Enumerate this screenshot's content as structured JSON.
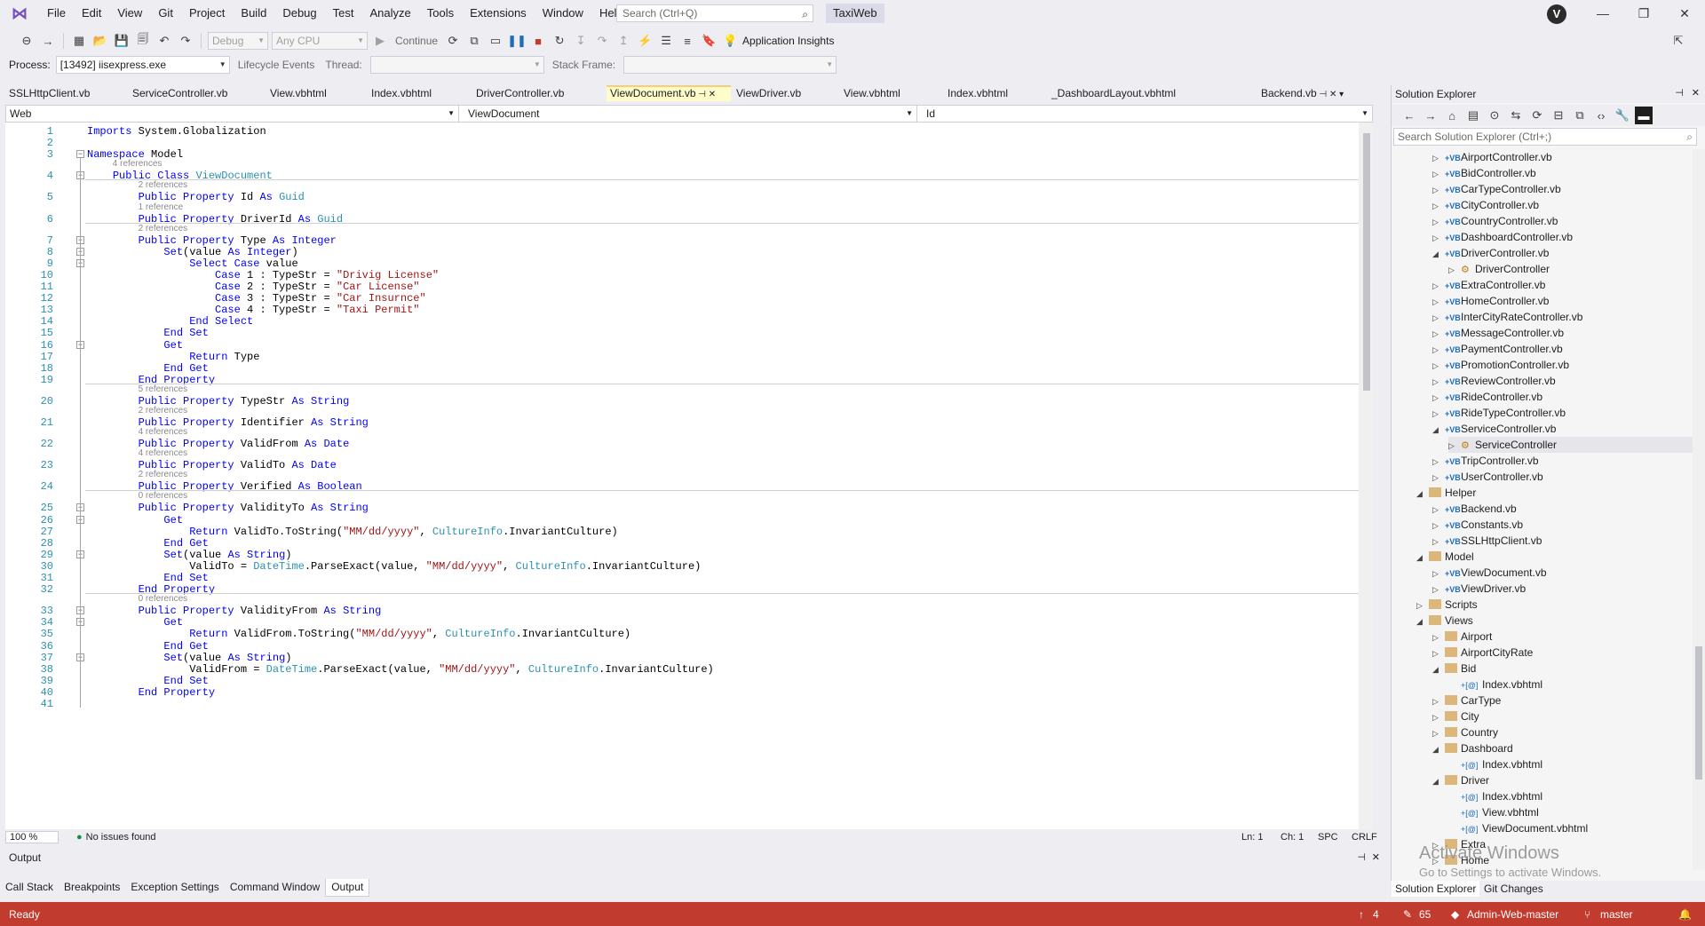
{
  "menu": {
    "items": [
      "File",
      "Edit",
      "View",
      "Git",
      "Project",
      "Build",
      "Debug",
      "Test",
      "Analyze",
      "Tools",
      "Extensions",
      "Window",
      "Help"
    ],
    "search_placeholder": "Search (Ctrl+Q)",
    "solution_name": "TaxiWeb",
    "user_initial": "V"
  },
  "toolbar": {
    "config": "Debug",
    "platform": "Any CPU",
    "continue_label": "Continue",
    "app_insights": "Application Insights"
  },
  "process_bar": {
    "process_label": "Process:",
    "process_value": "[13492] iisexpress.exe",
    "lifecycle": "Lifecycle Events",
    "thread_label": "Thread:",
    "stack_label": "Stack Frame:"
  },
  "tabs": [
    "SSLHttpClient.vb",
    "ServiceController.vb",
    "View.vbhtml",
    "Index.vbhtml",
    "DriverController.vb",
    "ViewDocument.vb",
    "ViewDriver.vb",
    "View.vbhtml",
    "Index.vbhtml",
    "_DashboardLayout.vbhtml"
  ],
  "active_tab": "ViewDocument.vb",
  "right_tab": "Backend.vb",
  "navbar": {
    "project": "Web",
    "class": "ViewDocument",
    "member": "Id"
  },
  "editor": {
    "lines": [
      {
        "n": "1",
        "html": "<span class='kw'>Imports</span> System.Globalization"
      },
      {
        "n": "2",
        "html": ""
      },
      {
        "n": "3",
        "html": "<span class='kw'>Namespace</span> Model"
      },
      {
        "n": "4",
        "html": "    <span class='kw'>Public Class</span> <span class='ty'>ViewDocument</span>"
      },
      {
        "n": "5",
        "html": "        <span class='kw'>Public Property</span> Id <span class='kw'>As</span> <span class='ty'>Guid</span>"
      },
      {
        "n": "6",
        "html": "        <span class='kw'>Public Property</span> DriverId <span class='kw'>As</span> <span class='ty'>Guid</span>"
      },
      {
        "n": "7",
        "html": "        <span class='kw'>Public Property</span> Type <span class='kw'>As Integer</span>"
      },
      {
        "n": "8",
        "html": "            <span class='kw'>Set</span>(value <span class='kw'>As Integer</span>)"
      },
      {
        "n": "9",
        "html": "                <span class='kw'>Select Case</span> value"
      },
      {
        "n": "10",
        "html": "                    <span class='kw'>Case</span> 1 : TypeStr = <span class='st'>\"Drivig License\"</span>"
      },
      {
        "n": "11",
        "html": "                    <span class='kw'>Case</span> 2 : TypeStr = <span class='st'>\"Car License\"</span>"
      },
      {
        "n": "12",
        "html": "                    <span class='kw'>Case</span> 3 : TypeStr = <span class='st'>\"Car Insurnce\"</span>"
      },
      {
        "n": "13",
        "html": "                    <span class='kw'>Case</span> 4 : TypeStr = <span class='st'>\"Taxi Permit\"</span>"
      },
      {
        "n": "14",
        "html": "                <span class='kw'>End Select</span>"
      },
      {
        "n": "15",
        "html": "            <span class='kw'>End Set</span>"
      },
      {
        "n": "16",
        "html": "            <span class='kw'>Get</span>"
      },
      {
        "n": "17",
        "html": "                <span class='kw'>Return</span> Type"
      },
      {
        "n": "18",
        "html": "            <span class='kw'>End Get</span>"
      },
      {
        "n": "19",
        "html": "        <span class='kw'>End Property</span>"
      },
      {
        "n": "20",
        "html": "        <span class='kw'>Public Property</span> TypeStr <span class='kw'>As String</span>"
      },
      {
        "n": "21",
        "html": "        <span class='kw'>Public Property</span> Identifier <span class='kw'>As String</span>"
      },
      {
        "n": "22",
        "html": "        <span class='kw'>Public Property</span> ValidFrom <span class='kw'>As Date</span>"
      },
      {
        "n": "23",
        "html": "        <span class='kw'>Public Property</span> ValidTo <span class='kw'>As Date</span>"
      },
      {
        "n": "24",
        "html": "        <span class='kw'>Public Property</span> Verified <span class='kw'>As Boolean</span>"
      },
      {
        "n": "25",
        "html": "        <span class='kw'>Public Property</span> ValidityTo <span class='kw'>As String</span>"
      },
      {
        "n": "26",
        "html": "            <span class='kw'>Get</span>"
      },
      {
        "n": "27",
        "html": "                <span class='kw'>Return</span> ValidTo.ToString(<span class='st'>\"MM/dd/yyyy\"</span>, <span class='ty'>CultureInfo</span>.InvariantCulture)"
      },
      {
        "n": "28",
        "html": "            <span class='kw'>End Get</span>"
      },
      {
        "n": "29",
        "html": "            <span class='kw'>Set</span>(value <span class='kw'>As String</span>)"
      },
      {
        "n": "30",
        "html": "                ValidTo = <span class='ty'>DateTime</span>.ParseExact(value, <span class='st'>\"MM/dd/yyyy\"</span>, <span class='ty'>CultureInfo</span>.InvariantCulture)"
      },
      {
        "n": "31",
        "html": "            <span class='kw'>End Set</span>"
      },
      {
        "n": "32",
        "html": "        <span class='kw'>End Property</span>"
      },
      {
        "n": "33",
        "html": "        <span class='kw'>Public Property</span> ValidityFrom <span class='kw'>As String</span>"
      },
      {
        "n": "34",
        "html": "            <span class='kw'>Get</span>"
      },
      {
        "n": "35",
        "html": "                <span class='kw'>Return</span> ValidFrom.ToString(<span class='st'>\"MM/dd/yyyy\"</span>, <span class='ty'>CultureInfo</span>.InvariantCulture)"
      },
      {
        "n": "36",
        "html": "            <span class='kw'>End Get</span>"
      },
      {
        "n": "37",
        "html": "            <span class='kw'>Set</span>(value <span class='kw'>As String</span>)"
      },
      {
        "n": "38",
        "html": "                ValidFrom = <span class='ty'>DateTime</span>.ParseExact(value, <span class='st'>\"MM/dd/yyyy\"</span>, <span class='ty'>CultureInfo</span>.InvariantCulture)"
      },
      {
        "n": "39",
        "html": "            <span class='kw'>End Set</span>"
      },
      {
        "n": "40",
        "html": "        <span class='kw'>End Property</span>"
      },
      {
        "n": "41",
        "html": ""
      }
    ],
    "refs": [
      {
        "before": "4",
        "text": "4 references"
      },
      {
        "before": "5",
        "text": "2 references"
      },
      {
        "before": "6",
        "text": "1 reference"
      },
      {
        "before": "7",
        "text": "2 references"
      },
      {
        "before": "20",
        "text": "5 references"
      },
      {
        "before": "21",
        "text": "2 references"
      },
      {
        "before": "22",
        "text": "4 references"
      },
      {
        "before": "23",
        "text": "4 references"
      },
      {
        "before": "24",
        "text": "2 references"
      },
      {
        "before": "25",
        "text": "0 references"
      },
      {
        "before": "33",
        "text": "0 references"
      }
    ]
  },
  "editor_footer": {
    "zoom": "100 %",
    "issues": "No issues found",
    "ln": "Ln: 1",
    "ch": "Ch: 1",
    "spc": "SPC",
    "crlf": "CRLF"
  },
  "solution_explorer": {
    "title": "Solution Explorer",
    "search_placeholder": "Search Solution Explorer (Ctrl+;)",
    "tree": [
      {
        "label": "AirportController.vb",
        "kind": "vb",
        "depth": 2,
        "exp": "▷"
      },
      {
        "label": "BidController.vb",
        "kind": "vb",
        "depth": 2,
        "exp": "▷"
      },
      {
        "label": "CarTypeController.vb",
        "kind": "vb",
        "depth": 2,
        "exp": "▷"
      },
      {
        "label": "CityController.vb",
        "kind": "vb",
        "depth": 2,
        "exp": "▷"
      },
      {
        "label": "CountryController.vb",
        "kind": "vb",
        "depth": 2,
        "exp": "▷"
      },
      {
        "label": "DashboardController.vb",
        "kind": "vb",
        "depth": 2,
        "exp": "▷"
      },
      {
        "label": "DriverController.vb",
        "kind": "vb",
        "depth": 2,
        "exp": "◢"
      },
      {
        "label": "DriverController",
        "kind": "cls",
        "depth": 3,
        "exp": "▷"
      },
      {
        "label": "ExtraController.vb",
        "kind": "vb",
        "depth": 2,
        "exp": "▷"
      },
      {
        "label": "HomeController.vb",
        "kind": "vb",
        "depth": 2,
        "exp": "▷"
      },
      {
        "label": "InterCityRateController.vb",
        "kind": "vb",
        "depth": 2,
        "exp": "▷"
      },
      {
        "label": "MessageController.vb",
        "kind": "vb",
        "depth": 2,
        "exp": "▷"
      },
      {
        "label": "PaymentController.vb",
        "kind": "vb",
        "depth": 2,
        "exp": "▷"
      },
      {
        "label": "PromotionController.vb",
        "kind": "vb",
        "depth": 2,
        "exp": "▷"
      },
      {
        "label": "ReviewController.vb",
        "kind": "vb",
        "depth": 2,
        "exp": "▷"
      },
      {
        "label": "RideController.vb",
        "kind": "vb",
        "depth": 2,
        "exp": "▷"
      },
      {
        "label": "RideTypeController.vb",
        "kind": "vb",
        "depth": 2,
        "exp": "▷"
      },
      {
        "label": "ServiceController.vb",
        "kind": "vb",
        "depth": 2,
        "exp": "◢"
      },
      {
        "label": "ServiceController",
        "kind": "cls",
        "depth": 3,
        "exp": "▷"
      },
      {
        "label": "TripController.vb",
        "kind": "vb",
        "depth": 2,
        "exp": "▷"
      },
      {
        "label": "UserController.vb",
        "kind": "vb",
        "depth": 2,
        "exp": "▷"
      },
      {
        "label": "Helper",
        "kind": "folder",
        "depth": 1,
        "exp": "◢"
      },
      {
        "label": "Backend.vb",
        "kind": "vb",
        "depth": 2,
        "exp": "▷"
      },
      {
        "label": "Constants.vb",
        "kind": "vb",
        "depth": 2,
        "exp": "▷"
      },
      {
        "label": "SSLHttpClient.vb",
        "kind": "vb",
        "depth": 2,
        "exp": "▷"
      },
      {
        "label": "Model",
        "kind": "folder",
        "depth": 1,
        "exp": "◢"
      },
      {
        "label": "ViewDocument.vb",
        "kind": "vb",
        "depth": 2,
        "exp": "▷"
      },
      {
        "label": "ViewDriver.vb",
        "kind": "vb",
        "depth": 2,
        "exp": "▷"
      },
      {
        "label": "Scripts",
        "kind": "folder",
        "depth": 1,
        "exp": "▷"
      },
      {
        "label": "Views",
        "kind": "folder",
        "depth": 1,
        "exp": "◢"
      },
      {
        "label": "Airport",
        "kind": "folder",
        "depth": 2,
        "exp": "▷"
      },
      {
        "label": "AirportCityRate",
        "kind": "folder",
        "depth": 2,
        "exp": "▷"
      },
      {
        "label": "Bid",
        "kind": "folder",
        "depth": 2,
        "exp": "◢"
      },
      {
        "label": "Index.vbhtml",
        "kind": "vbh",
        "depth": 3,
        "exp": ""
      },
      {
        "label": "CarType",
        "kind": "folder",
        "depth": 2,
        "exp": "▷"
      },
      {
        "label": "City",
        "kind": "folder",
        "depth": 2,
        "exp": "▷"
      },
      {
        "label": "Country",
        "kind": "folder",
        "depth": 2,
        "exp": "▷"
      },
      {
        "label": "Dashboard",
        "kind": "folder",
        "depth": 2,
        "exp": "◢"
      },
      {
        "label": "Index.vbhtml",
        "kind": "vbh",
        "depth": 3,
        "exp": ""
      },
      {
        "label": "Driver",
        "kind": "folder",
        "depth": 2,
        "exp": "◢"
      },
      {
        "label": "Index.vbhtml",
        "kind": "vbh",
        "depth": 3,
        "exp": ""
      },
      {
        "label": "View.vbhtml",
        "kind": "vbh",
        "depth": 3,
        "exp": ""
      },
      {
        "label": "ViewDocument.vbhtml",
        "kind": "vbh",
        "depth": 3,
        "exp": ""
      },
      {
        "label": "Extra",
        "kind": "folder",
        "depth": 2,
        "exp": "▷"
      },
      {
        "label": "Home",
        "kind": "folder",
        "depth": 2,
        "exp": "▷"
      }
    ],
    "tabs": [
      "Solution Explorer",
      "Git Changes"
    ]
  },
  "output": {
    "title": "Output",
    "bottom_tabs": [
      "Call Stack",
      "Breakpoints",
      "Exception Settings",
      "Command Window",
      "Output"
    ],
    "active_bottom_tab": "Output"
  },
  "watermark": {
    "line1": "Activate Windows",
    "line2": "Go to Settings to activate Windows."
  },
  "statusbar": {
    "ready": "Ready",
    "up_count": "4",
    "pencil_count": "65",
    "repo": "Admin-Web-master",
    "branch": "master"
  },
  "colors": {
    "statusbar": "#c13c2f",
    "active_tab": "#fefcc8",
    "keyword": "#0000ff",
    "type": "#2b91af",
    "string": "#a31515"
  }
}
